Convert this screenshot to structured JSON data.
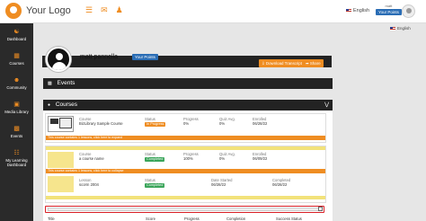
{
  "header": {
    "logo_text": "Your Logo",
    "language": "English",
    "user_small": "matt",
    "points_label": "Your Points"
  },
  "sidebar": {
    "items": [
      {
        "label": "Dashboard",
        "icon": "dashboard-icon"
      },
      {
        "label": "Courses",
        "icon": "courses-icon"
      },
      {
        "label": "Community",
        "icon": "community-icon"
      },
      {
        "label": "Media Library",
        "icon": "media-library-icon"
      },
      {
        "label": "Events",
        "icon": "events-icon"
      },
      {
        "label": "My Learning Dashboard",
        "icon": "learning-dashboard-icon"
      }
    ]
  },
  "main": {
    "language": "English",
    "profile": {
      "name": "matt pannella",
      "points_label": "Your Points",
      "download_transcript": "Download Transcript",
      "share": "Share"
    },
    "events_title": "Events",
    "courses_title": "Courses",
    "courses": [
      {
        "label": "Course",
        "name": "BizLibrary Sample Course",
        "status_label": "Status",
        "status": "In Progress",
        "progress_label": "Progress",
        "progress": "0%",
        "quiz_label": "Quiz Avg.",
        "quiz": "0%",
        "enrolled_label": "Enrolled",
        "enrolled": "06/28/22",
        "warning": "This course contains 1 lessons, click here to expand"
      },
      {
        "label": "Course",
        "name": "a course name",
        "status_label": "Status",
        "status": "Completed",
        "progress_label": "Progress",
        "progress": "100%",
        "quiz_label": "Quiz Avg.",
        "quiz": "0%",
        "enrolled_label": "Enrolled",
        "enrolled": "06/09/22",
        "warning": "This course contains 1 lessons, click here to collapse",
        "lesson": {
          "label": "Lesson",
          "name": "scorm 2004",
          "status_label": "Status",
          "status": "Completed",
          "date_label": "Date Started",
          "date": "06/28/22",
          "completed_label": "Completed",
          "completed": "06/28/22"
        }
      }
    ],
    "activity_table": {
      "headers": [
        "Title",
        "Score",
        "Progress",
        "Completion",
        "Success Status"
      ]
    },
    "colors": {
      "accent": "#ef8d22",
      "dark": "#232323",
      "badge_blue": "#2a6db5",
      "completed_green": "#3aa55a",
      "highlight_red": "#d81f26"
    }
  }
}
